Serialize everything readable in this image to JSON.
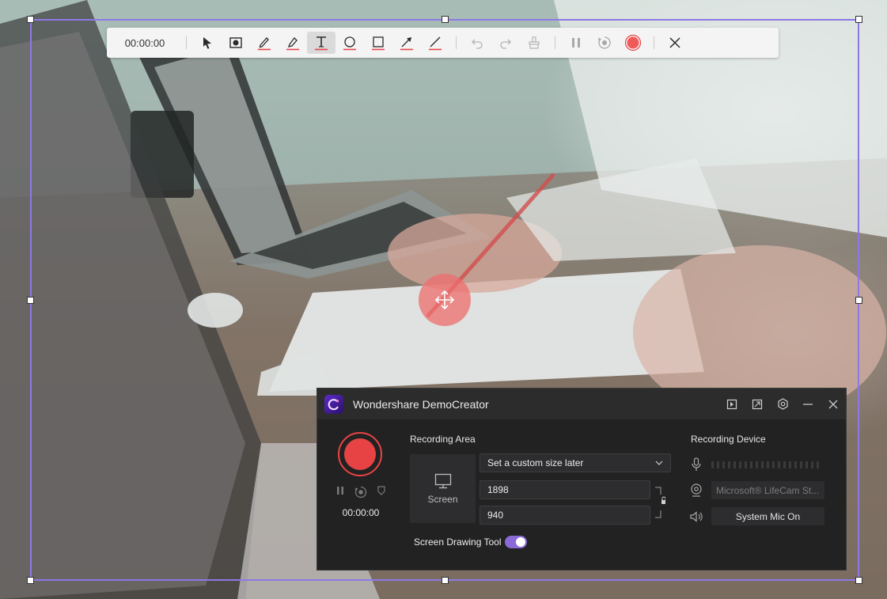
{
  "draw_toolbar": {
    "timer": "00:00:00",
    "tools": [
      {
        "name": "select-tool-button",
        "icon": "cursor-arrow-icon",
        "active": false
      },
      {
        "name": "spotlight-tool-button",
        "icon": "spotlight-icon",
        "active": false
      },
      {
        "name": "pen-tool-button",
        "icon": "pen-icon",
        "active": false
      },
      {
        "name": "highlighter-tool-button",
        "icon": "highlighter-icon",
        "active": false
      },
      {
        "name": "text-tool-button",
        "icon": "text-icon",
        "active": true
      },
      {
        "name": "ellipse-tool-button",
        "icon": "ellipse-icon",
        "active": false
      },
      {
        "name": "rectangle-tool-button",
        "icon": "rectangle-icon",
        "active": false
      },
      {
        "name": "arrow-tool-button",
        "icon": "arrow-icon",
        "active": false
      },
      {
        "name": "line-tool-button",
        "icon": "line-icon",
        "active": false
      }
    ],
    "accent_color": "#e84344"
  },
  "panel": {
    "app_title": "Wondershare DemoCreator",
    "title_icons": [
      "sidebar-toggle-icon",
      "pip-icon",
      "settings-icon",
      "minimize-icon",
      "close-icon"
    ],
    "record_timer": "00:00:00",
    "recording_area_label": "Recording Area",
    "screen_label": "Screen",
    "size_select_value": "Set a custom size later",
    "width_value": "1898",
    "height_value": "940",
    "drawing_tool_label": "Screen Drawing Tool",
    "drawing_tool_enabled": true,
    "recording_device_label": "Recording Device",
    "camera_value": "Microsoft® LifeCam St...",
    "audio_value": "System Mic On",
    "toggle_color": "#8b6ad8",
    "record_color": "#e84344"
  },
  "selection": {
    "frame_color": "#8e78e6"
  }
}
